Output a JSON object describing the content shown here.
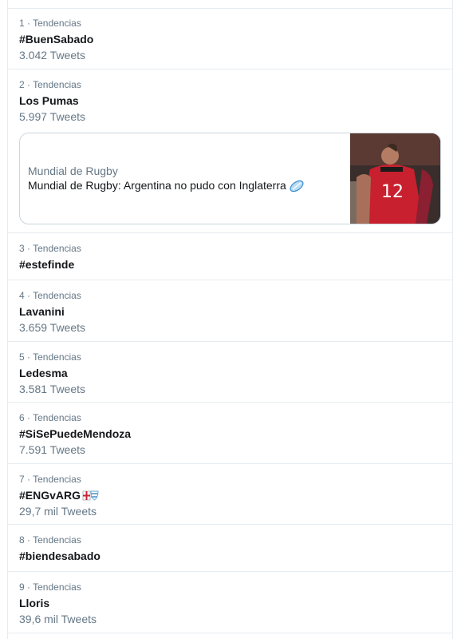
{
  "trends": [
    {
      "meta": "1 · Tendencias",
      "name": "#BuenSabado",
      "count": "3.042 Tweets"
    },
    {
      "meta": "2 · Tendencias",
      "name": "Los Pumas",
      "count": "5.997 Tweets",
      "card": {
        "source": "Mundial de Rugby",
        "title": "Mundial de Rugby: Argentina no pudo con Inglaterra",
        "emoji": "rugby-ball-icon",
        "jersey_number": "12"
      }
    },
    {
      "meta": "3 · Tendencias",
      "name": "#estefinde"
    },
    {
      "meta": "4 · Tendencias",
      "name": "Lavanini",
      "count": "3.659 Tweets"
    },
    {
      "meta": "5 · Tendencias",
      "name": "Ledesma",
      "count": "3.581 Tweets"
    },
    {
      "meta": "6 · Tendencias",
      "name": "#SiSePuedeMendoza",
      "count": "7.591 Tweets"
    },
    {
      "meta": "7 · Tendencias",
      "name": "#ENGvARG",
      "count": "29,7 mil Tweets",
      "hashflag": "eng-arg-flag-icon"
    },
    {
      "meta": "8 · Tendencias",
      "name": "#biendesabado"
    },
    {
      "meta": "9 · Tendencias",
      "name": "Lloris",
      "count": "39,6 mil Tweets"
    }
  ],
  "colors": {
    "text": "#14171a",
    "muted": "#657786",
    "border": "#e6ecf0",
    "jersey": "#c8202f"
  }
}
